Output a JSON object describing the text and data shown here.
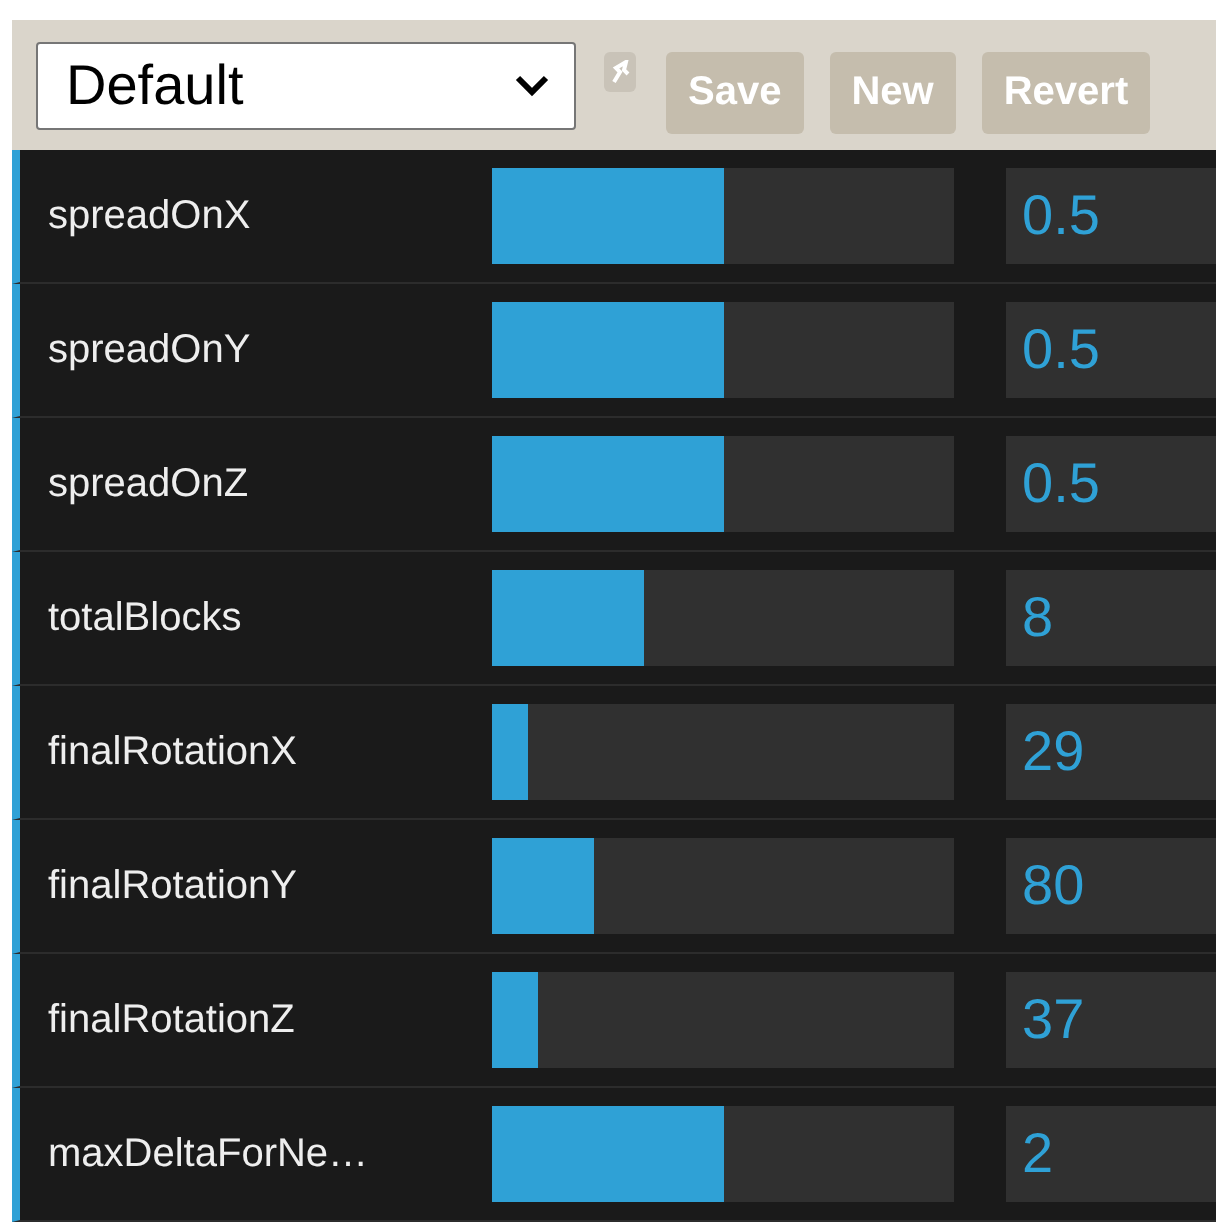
{
  "presets": {
    "selected_preset": "Default",
    "remember_checked": false,
    "buttons": [
      "Save",
      "New",
      "Revert"
    ]
  },
  "controllers": [
    {
      "label": "spreadOnX",
      "level": 0.5,
      "value": "0.5"
    },
    {
      "label": "spreadOnY",
      "level": 0.5,
      "value": "0.5"
    },
    {
      "label": "spreadOnZ",
      "level": 0.5,
      "value": "0.5"
    },
    {
      "label": "totalBlocks",
      "level": 0.33,
      "value": "8"
    },
    {
      "label": "finalRotationX",
      "level": 0.08,
      "value": "29"
    },
    {
      "label": "finalRotationY",
      "level": 0.22,
      "value": "80"
    },
    {
      "label": "finalRotationZ",
      "level": 0.1,
      "value": "37"
    },
    {
      "label": "maxDeltaForNe…",
      "level": 0.5,
      "value": "2"
    }
  ]
}
